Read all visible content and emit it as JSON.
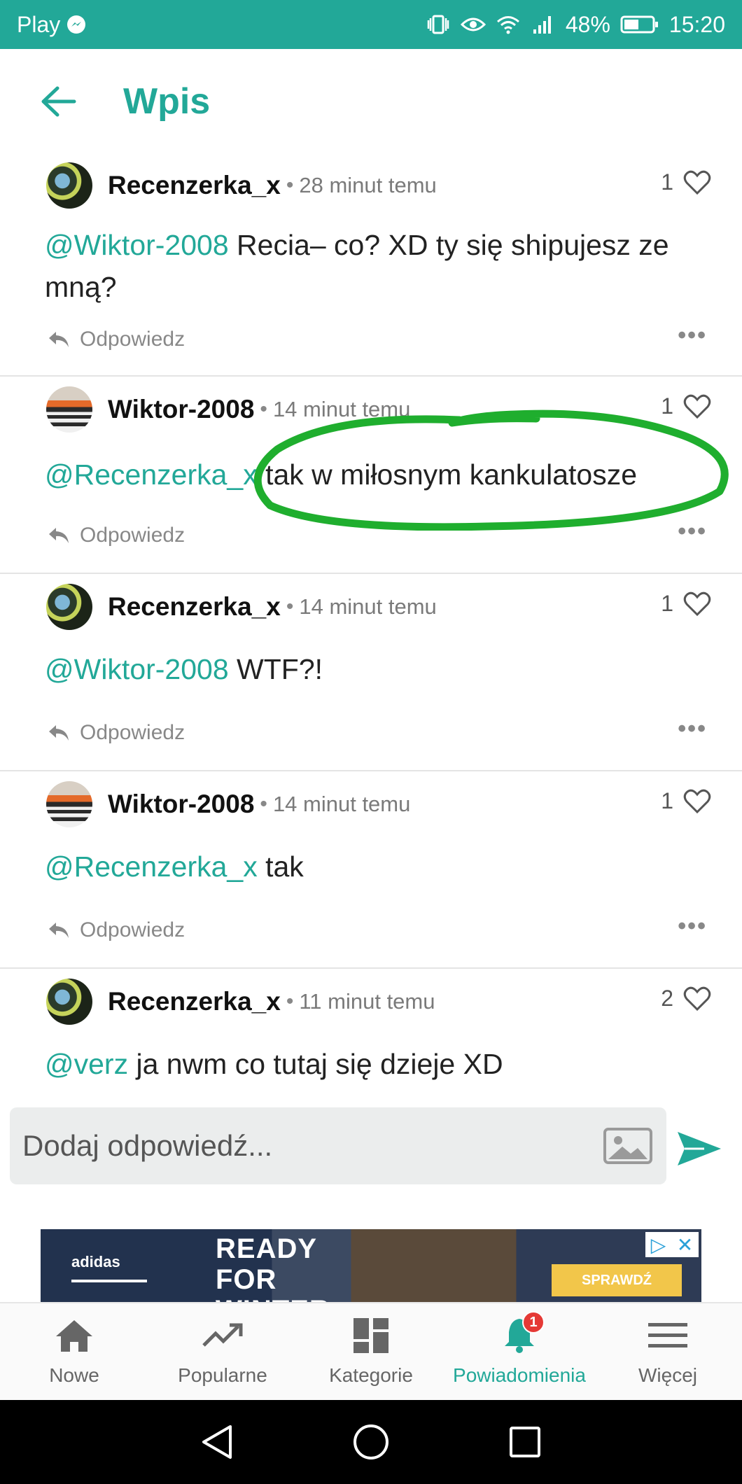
{
  "status_bar": {
    "carrier": "Play",
    "battery": "48%",
    "time": "15:20"
  },
  "header": {
    "title": "Wpis"
  },
  "comments": [
    {
      "author": "Recenzerka_x",
      "avatar": "recenzerka-avatar",
      "time": "28 minut temu",
      "likes": "1",
      "mention": "@Wiktor-2008",
      "text": " Recia– co? XD ty się shipujesz ze mną?",
      "reply_label": "Odpowiedz"
    },
    {
      "author": "Wiktor-2008",
      "avatar": "wiktor-avatar",
      "time": "14 minut temu",
      "likes": "1",
      "mention": "@Recenzerka_x",
      "text": " tak w miłosnym kankulatosze",
      "reply_label": "Odpowiedz"
    },
    {
      "author": "Recenzerka_x",
      "avatar": "recenzerka-avatar",
      "time": "14 minut temu",
      "likes": "1",
      "mention": "@Wiktor-2008",
      "text": " WTF?!",
      "reply_label": "Odpowiedz"
    },
    {
      "author": "Wiktor-2008",
      "avatar": "wiktor-avatar",
      "time": "14 minut temu",
      "likes": "1",
      "mention": "@Recenzerka_x",
      "text": " tak",
      "reply_label": "Odpowiedz"
    },
    {
      "author": "Recenzerka_x",
      "avatar": "recenzerka-avatar",
      "time": "11 minut temu",
      "likes": "2",
      "mention": "@verz",
      "text": " ja nwm co tutaj się dzieje XD",
      "reply_label": "Odpowiedz"
    }
  ],
  "reply_input": {
    "placeholder": "Dodaj odpowiedź..."
  },
  "ad": {
    "brand": "adidas",
    "headline": "READY\nFOR\nWINTER",
    "cta": "SPRAWDŹ"
  },
  "bottom_nav": {
    "items": [
      {
        "label": "Nowe",
        "icon": "home-icon"
      },
      {
        "label": "Popularne",
        "icon": "trending-icon"
      },
      {
        "label": "Kategorie",
        "icon": "categories-icon"
      },
      {
        "label": "Powiadomienia",
        "icon": "bell-icon",
        "badge": "1"
      },
      {
        "label": "Więcej",
        "icon": "menu-icon"
      }
    ]
  },
  "colors": {
    "accent": "#22a898",
    "annotation": "#1fae2e",
    "badge": "#e53935"
  }
}
